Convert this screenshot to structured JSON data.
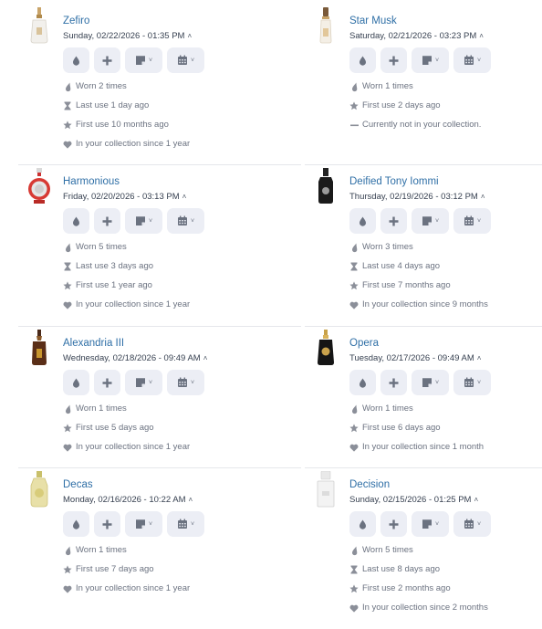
{
  "entries": [
    {
      "name": "Zefiro",
      "date": "Sunday, 02/22/2026 - 01:35 PM",
      "bottle": "clear",
      "stats": [
        {
          "icon": "drop-icon",
          "text": "Worn 2 times"
        },
        {
          "icon": "hourglass-icon",
          "text": "Last use 1 day ago"
        },
        {
          "icon": "star-icon",
          "text": "First use 10 months ago"
        },
        {
          "icon": "heart-icon",
          "text": "In your collection since 1 year"
        }
      ]
    },
    {
      "name": "Star Musk",
      "date": "Saturday, 02/21/2026 - 03:23 PM",
      "bottle": "amber-cap",
      "stats": [
        {
          "icon": "drop-icon",
          "text": "Worn 1 times"
        },
        {
          "icon": "star-icon",
          "text": "First use 2 days ago"
        },
        {
          "icon": "minus-icon",
          "text": "Currently not in your collection."
        }
      ]
    },
    {
      "name": "Harmonious",
      "date": "Friday, 02/20/2026 - 03:13 PM",
      "bottle": "red-ring",
      "stats": [
        {
          "icon": "drop-icon",
          "text": "Worn 5 times"
        },
        {
          "icon": "hourglass-icon",
          "text": "Last use 3 days ago"
        },
        {
          "icon": "star-icon",
          "text": "First use 1 year ago"
        },
        {
          "icon": "heart-icon",
          "text": "In your collection since 1 year"
        }
      ]
    },
    {
      "name": "Deified Tony Iommi",
      "date": "Thursday, 02/19/2026 - 03:12 PM",
      "bottle": "black",
      "stats": [
        {
          "icon": "drop-icon",
          "text": "Worn 3 times"
        },
        {
          "icon": "hourglass-icon",
          "text": "Last use 4 days ago"
        },
        {
          "icon": "star-icon",
          "text": "First use 7 months ago"
        },
        {
          "icon": "heart-icon",
          "text": "In your collection since 9 months"
        }
      ]
    },
    {
      "name": "Alexandria III",
      "date": "Wednesday, 02/18/2026 - 09:49 AM",
      "bottle": "brown",
      "stats": [
        {
          "icon": "drop-icon",
          "text": "Worn 1 times"
        },
        {
          "icon": "star-icon",
          "text": "First use 5 days ago"
        },
        {
          "icon": "heart-icon",
          "text": "In your collection since 1 year"
        }
      ]
    },
    {
      "name": "Opera",
      "date": "Tuesday, 02/17/2026 - 09:49 AM",
      "bottle": "black-gold",
      "stats": [
        {
          "icon": "drop-icon",
          "text": "Worn 1 times"
        },
        {
          "icon": "star-icon",
          "text": "First use 6 days ago"
        },
        {
          "icon": "heart-icon",
          "text": "In your collection since 1 month"
        }
      ]
    },
    {
      "name": "Decas",
      "date": "Monday, 02/16/2026 - 10:22 AM",
      "bottle": "yellow",
      "stats": [
        {
          "icon": "drop-icon",
          "text": "Worn 1 times"
        },
        {
          "icon": "star-icon",
          "text": "First use 7 days ago"
        },
        {
          "icon": "heart-icon",
          "text": "In your collection since 1 year"
        }
      ]
    },
    {
      "name": "Decision",
      "date": "Sunday, 02/15/2026 - 01:25 PM",
      "bottle": "white",
      "stats": [
        {
          "icon": "drop-icon",
          "text": "Worn 5 times"
        },
        {
          "icon": "hourglass-icon",
          "text": "Last use 8 days ago"
        },
        {
          "icon": "star-icon",
          "text": "First use 2 months ago"
        },
        {
          "icon": "heart-icon",
          "text": "In your collection since 2 months"
        }
      ]
    }
  ],
  "actions": [
    {
      "name": "drop-button",
      "icon": "drop-icon",
      "dropdown": false
    },
    {
      "name": "add-button",
      "icon": "plus-icon",
      "dropdown": false
    },
    {
      "name": "note-button",
      "icon": "note-icon",
      "dropdown": true
    },
    {
      "name": "calendar-button",
      "icon": "calendar-icon",
      "dropdown": true
    }
  ],
  "colors": {
    "title": "#2f6fa6",
    "button_bg": "#eceef5",
    "icon": "#6b7280",
    "divider": "#e5e7eb"
  }
}
